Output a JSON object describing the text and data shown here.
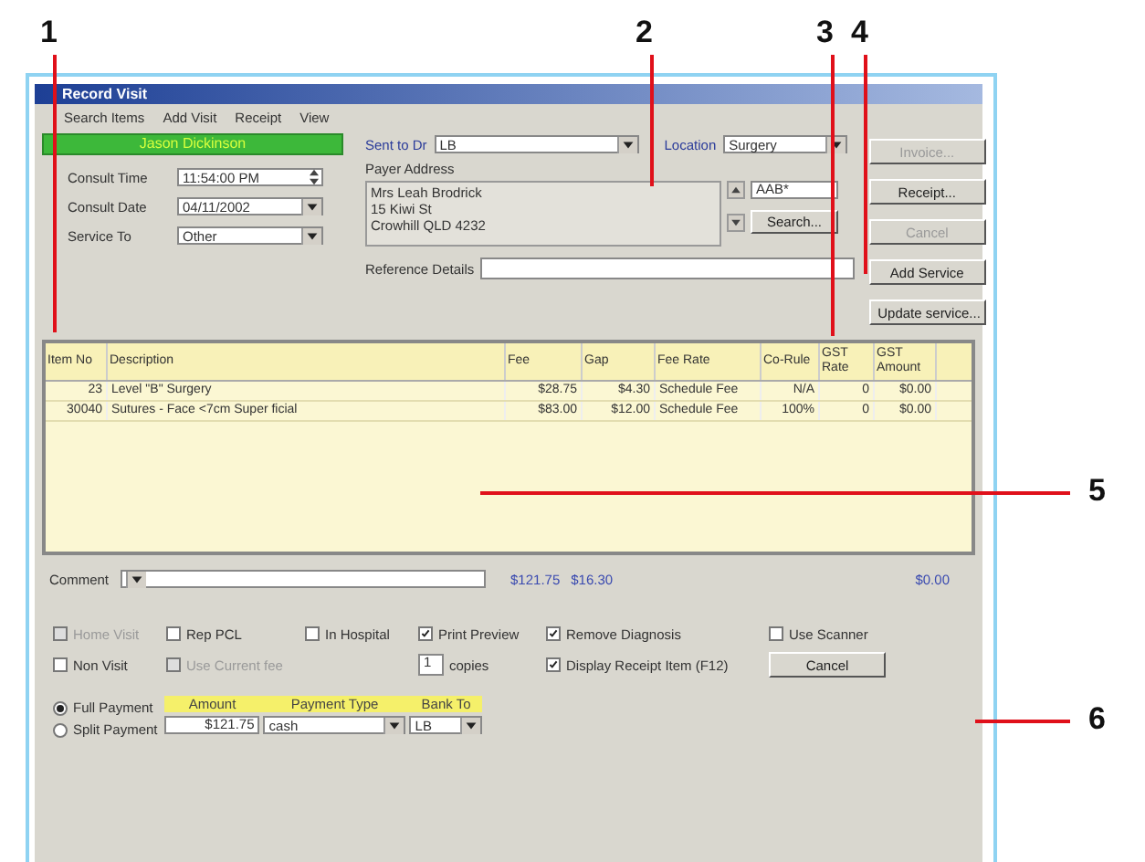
{
  "callouts": [
    {
      "label": "1"
    },
    {
      "label": "2"
    },
    {
      "label": "3"
    },
    {
      "label": "4"
    },
    {
      "label": "5"
    },
    {
      "label": "6"
    }
  ],
  "window": {
    "title": "Record Visit"
  },
  "menu": [
    "Search Items",
    "Add Visit",
    "Receipt",
    "View"
  ],
  "patient_banner": "Jason Dickinson",
  "sent_to_dr": {
    "label": "Sent to Dr",
    "value": "LB"
  },
  "location": {
    "label": "Location",
    "value": "Surgery"
  },
  "left_fields": [
    {
      "label": "Consult Time",
      "value": "11:54:00 PM",
      "kind": "spinner"
    },
    {
      "label": "Consult Date",
      "value": "04/11/2002",
      "kind": "dropdown"
    },
    {
      "label": "Service To",
      "value": "Other",
      "kind": "dropdown"
    }
  ],
  "payer_address": {
    "label": "Payer Address",
    "lines": [
      "Mrs Leah Brodrick",
      "15 Kiwi St",
      "Crowhill  QLD  4232"
    ]
  },
  "code_field": {
    "value": "AAB*"
  },
  "search_button": "Search...",
  "reference": {
    "label": "Reference Details"
  },
  "side_buttons": [
    {
      "label": "Invoice...",
      "disabled": true
    },
    {
      "label": "Receipt...",
      "disabled": false
    },
    {
      "label": "Cancel",
      "disabled": true
    },
    {
      "label": "Add Service",
      "disabled": false
    },
    {
      "label": "Update service...",
      "disabled": false
    }
  ],
  "table": {
    "columns": [
      "Item No",
      "Description",
      "Fee",
      "Gap",
      "Fee Rate",
      "Co-Rule",
      "GST Rate",
      "GST Amount"
    ],
    "rows": [
      [
        "23",
        "Level \"B\" Surgery",
        "$28.75",
        "$4.30",
        "Schedule Fee",
        "N/A",
        "0",
        "$0.00"
      ],
      [
        "30040",
        "Sutures - Face <7cm Super ficial",
        "$83.00",
        "$12.00",
        "Schedule Fee",
        "100%",
        "0",
        "$0.00"
      ]
    ]
  },
  "comment": {
    "label": "Comment"
  },
  "totals": [
    "$121.75",
    "$16.30",
    "$0.00"
  ],
  "options": [
    [
      {
        "kind": "checkbox",
        "label": "Home Visit",
        "checked": false,
        "disabled": true
      },
      {
        "kind": "checkbox",
        "label": "Rep PCL",
        "checked": false,
        "disabled": false
      },
      {
        "kind": "checkbox",
        "label": "In Hospital",
        "checked": false,
        "disabled": false
      },
      {
        "kind": "checkbox",
        "label": "Print Preview",
        "checked": true,
        "disabled": false
      },
      {
        "kind": "checkbox",
        "label": "Remove Diagnosis",
        "checked": true,
        "disabled": false
      },
      {
        "kind": "checkbox",
        "label": "Use Scanner",
        "checked": false,
        "disabled": false
      }
    ],
    [
      {
        "kind": "checkbox",
        "label": "Non Visit",
        "checked": false,
        "disabled": false
      },
      {
        "kind": "checkbox",
        "label": "Use Current fee",
        "checked": false,
        "disabled": true
      },
      {
        "kind": "blank"
      },
      {
        "kind": "copies",
        "value": "1",
        "label": "copies"
      },
      {
        "kind": "checkbox",
        "label": "Display Receipt Item (F12)",
        "checked": true,
        "disabled": false
      },
      {
        "kind": "button",
        "label": "Cancel"
      }
    ]
  ],
  "payment": {
    "modes": [
      {
        "label": "Full Payment",
        "selected": true
      },
      {
        "label": "Split Payment",
        "selected": false
      }
    ],
    "columns": [
      "Amount",
      "Payment Type",
      "Bank To"
    ],
    "amount": "$121.75",
    "type": "cash",
    "bank": "LB"
  }
}
